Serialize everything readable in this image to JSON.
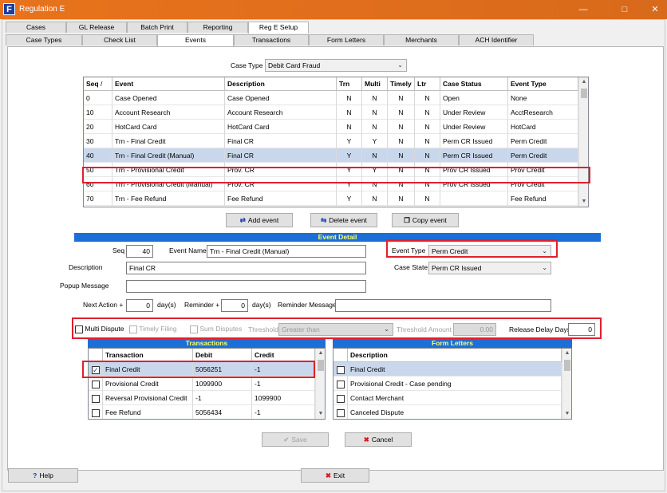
{
  "window": {
    "title": "Regulation E",
    "logo_letter": "F"
  },
  "main_tabs": [
    {
      "label": "Cases"
    },
    {
      "label": "GL Release"
    },
    {
      "label": "Batch Print"
    },
    {
      "label": "Reporting"
    },
    {
      "label": "Reg E Setup"
    }
  ],
  "sub_tabs": [
    {
      "label": "Case Types"
    },
    {
      "label": "Check List"
    },
    {
      "label": "Events"
    },
    {
      "label": "Transactions"
    },
    {
      "label": "Form Letters"
    },
    {
      "label": "Merchants"
    },
    {
      "label": "ACH Identifier"
    }
  ],
  "case_type": {
    "label": "Case Type",
    "value": "Debit Card Fraud"
  },
  "events_grid": {
    "headers": [
      "Seq",
      "Event",
      "Description",
      "Trn",
      "Multi",
      "Timely",
      "Ltr",
      "Case Status",
      "Event Type"
    ],
    "sort_indicator": "/",
    "rows": [
      [
        "0",
        "Case Opened",
        "Case Opened",
        "N",
        "N",
        "N",
        "N",
        "Open",
        "None"
      ],
      [
        "10",
        "Account Research",
        "Account Research",
        "N",
        "N",
        "N",
        "N",
        "Under Review",
        "AcctResearch"
      ],
      [
        "20",
        "HotCard Card",
        "HotCard Card",
        "N",
        "N",
        "N",
        "N",
        "Under Review",
        "HotCard"
      ],
      [
        "30",
        "Trn - Final Credit",
        "Final CR",
        "Y",
        "Y",
        "N",
        "N",
        "Perm CR Issued",
        "Perm Credit"
      ],
      [
        "40",
        "Trn - Final Credit (Manual)",
        "Final CR",
        "Y",
        "N",
        "N",
        "N",
        "Perm CR Issued",
        "Perm Credit"
      ],
      [
        "50",
        "Trn - Provisional Credit",
        "Prov. CR",
        "Y",
        "Y",
        "N",
        "N",
        "Prov CR Issued",
        "Prov Credit"
      ],
      [
        "60",
        "Trn - Provisional Credit (Manual)",
        "Prov. CR",
        "Y",
        "N",
        "N",
        "N",
        "Prov CR Issued",
        "Prov Credit"
      ],
      [
        "70",
        "Trn - Fee Refund",
        "Fee Refund",
        "Y",
        "N",
        "N",
        "N",
        "",
        "Fee Refund"
      ]
    ]
  },
  "actions": {
    "add": "Add event",
    "delete": "Delete event",
    "copy": "Copy event"
  },
  "event_detail": {
    "header": "Event Detail",
    "seq_label": "Seq",
    "seq_value": "40",
    "event_name_label": "Event Name",
    "event_name_value": "Trn - Final Credit (Manual)",
    "description_label": "Description",
    "description_value": "Final CR",
    "popup_label": "Popup Message",
    "popup_value": "",
    "event_type_label": "Event Type",
    "event_type_value": "Perm Credit",
    "case_state_label": "Case State",
    "case_state_value": "Perm CR Issued",
    "next_action_label": "Next Action +",
    "next_action_value": "0",
    "days1": "day(s)",
    "reminder_label": "Reminder +",
    "reminder_value": "0",
    "days2": "day(s)",
    "reminder_msg_label": "Reminder Message",
    "reminder_msg_value": "",
    "multi_dispute": "Multi Dispute",
    "timely_filing": "Timely Filing",
    "sum_disputes": "Sum Disputes",
    "threshold_label": "Threshold",
    "threshold_value": "Greater than",
    "threshold_amount_label": "Threshold Amount",
    "threshold_amount_value": "0.00",
    "release_delay_label": "Release Delay Days",
    "release_delay_value": "0"
  },
  "transactions": {
    "header": "Transactions",
    "columns": [
      "Transaction",
      "Debit",
      "Credit"
    ],
    "rows": [
      {
        "checked": true,
        "cells": [
          "Final Credit",
          "5056251",
          "-1"
        ]
      },
      {
        "checked": false,
        "cells": [
          "Provisional Credit",
          "1099900",
          "-1"
        ]
      },
      {
        "checked": false,
        "cells": [
          "Reversal Provisional Credit",
          "-1",
          "1099900"
        ]
      },
      {
        "checked": false,
        "cells": [
          "Fee Refund",
          "5056434",
          "-1"
        ]
      }
    ]
  },
  "form_letters": {
    "header": "Form Letters",
    "columns": [
      "Description"
    ],
    "rows": [
      {
        "checked": false,
        "cells": [
          "Final Credit"
        ]
      },
      {
        "checked": false,
        "cells": [
          "Provisional Credit - Case pending"
        ]
      },
      {
        "checked": false,
        "cells": [
          "Contact Merchant"
        ]
      },
      {
        "checked": false,
        "cells": [
          "Canceled Dispute"
        ]
      }
    ]
  },
  "form_buttons": {
    "save": "Save",
    "cancel": "Cancel"
  },
  "footer": {
    "help": "Help",
    "exit": "Exit"
  },
  "colors": {
    "accent": "#1c6fd6",
    "highlight": "#e0202c",
    "title_bar": "#e26f1c"
  }
}
